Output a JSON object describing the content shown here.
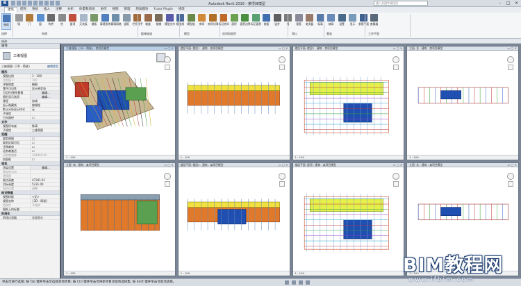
{
  "titlebar": {
    "app_letter": "R",
    "title": "Autodesk Revit 2016 -   某项目模型",
    "search_placeholder": "键入关键字或短语",
    "min": "–",
    "max": "□",
    "close": "✕"
  },
  "tabs": [
    "建筑",
    "结构",
    "系统",
    "插入",
    "注释",
    "分析",
    "体量和场地",
    "协作",
    "视图",
    "管理",
    "附加模块",
    "Fuzor Plugin",
    "修改"
  ],
  "ribbon": {
    "buttons": [
      "修改",
      "墙",
      "门",
      "窗",
      "构件",
      "柱",
      "屋顶",
      "天花板",
      "楼板",
      "幕墙系统",
      "幕墙网格",
      "竖梃",
      "栏杆扶手",
      "坡道",
      "楼梯",
      "模型文字",
      "模型线",
      "模型组",
      "房间",
      "房间分隔",
      "标记房间",
      "面积",
      "面积边界",
      "标记面积",
      "按面",
      "竖井",
      "墙",
      "垂直",
      "老虎窗",
      "标高",
      "轴网",
      "设置",
      "显示",
      "参照平面",
      "查看器"
    ],
    "panels": [
      "选择",
      "构建",
      "楼梯坡道",
      "模型",
      "房间和面积",
      "洞口",
      "基准",
      "工作平面"
    ]
  },
  "substrip": {
    "label": "修改"
  },
  "properties": {
    "title": "属性",
    "type_name": "三维视图",
    "filter_label": "三维视图: {3D - 简易}",
    "edit_type": "编辑类型",
    "groups": [
      {
        "name": "图形",
        "rows": [
          {
            "k": "视图比例",
            "v": "1 : 100"
          },
          {
            "k": "比例值 1:",
            "v": "100",
            "grey": true
          },
          {
            "k": "详细程度",
            "v": "精细"
          },
          {
            "k": "零件可见性",
            "v": "显示原状态"
          },
          {
            "k": "可见性/图形替换",
            "v": "编辑...",
            "btn": true
          },
          {
            "k": "图形显示选项",
            "v": "编辑...",
            "btn": true
          },
          {
            "k": "规程",
            "v": "协调"
          },
          {
            "k": "显示隐藏线",
            "v": "按规程"
          },
          {
            "k": "默认分析显示样式",
            "v": "无"
          },
          {
            "k": "子规程",
            "v": ""
          },
          {
            "k": "日光路径",
            "v": "☐"
          }
        ]
      },
      {
        "name": "文字",
        "rows": [
          {
            "k": "视图所有者",
            "v": "陈瑛"
          },
          {
            "k": "子规程",
            "v": "三维视图"
          }
        ]
      },
      {
        "name": "范围",
        "rows": [
          {
            "k": "裁剪视图",
            "v": "☐"
          },
          {
            "k": "裁剪区域可见",
            "v": "☐"
          },
          {
            "k": "注释裁剪",
            "v": "☐"
          },
          {
            "k": "远剪裁激活",
            "v": "☐"
          },
          {
            "k": "远剪裁偏移",
            "v": "304800.00",
            "grey": true
          },
          {
            "k": "剖面框",
            "v": "☐"
          }
        ]
      },
      {
        "name": "相机",
        "rows": [
          {
            "k": "渲染设置",
            "v": "编辑...",
            "btn": true
          },
          {
            "k": "锁定的方向",
            "v": "",
            "grey": true
          },
          {
            "k": "透视图",
            "v": "",
            "grey": true
          },
          {
            "k": "视点高度",
            "v": "47341.61"
          },
          {
            "k": "目标高度",
            "v": "5231.00"
          },
          {
            "k": "相机位置",
            "v": "调整",
            "grey": true
          }
        ]
      },
      {
        "name": "标识数据",
        "rows": [
          {
            "k": "视图样板",
            "v": "<无>"
          },
          {
            "k": "视图名称",
            "v": "{3D - 简易}"
          },
          {
            "k": "相关性",
            "v": "不相关",
            "grey": true
          },
          {
            "k": "图纸上的标题",
            "v": ""
          }
        ]
      },
      {
        "name": "阶段化",
        "rows": [
          {
            "k": "阶段过滤器",
            "v": "全部显示"
          }
        ]
      }
    ]
  },
  "views": [
    {
      "title": "三维视图: {3D - 简易} - 某项目模型",
      "scale": "1 : 100"
    },
    {
      "title": "楼层平面: 楼层1 - 建筑 - 某项目模型",
      "scale": "1 : 100"
    },
    {
      "title": "楼层平面: 楼层2 - 建筑 - 某项目模型",
      "scale": "1 : 100"
    },
    {
      "title": "立面: 东 - 建筑 - 某项目模型",
      "scale": "1 : 100"
    },
    {
      "title": "立面: 南 - 建筑 - 某项目模型",
      "scale": "1 : 100"
    },
    {
      "title": "楼层平面: 楼层3 - 建筑 - 某项目模型",
      "scale": "1 : 100"
    },
    {
      "title": "楼层平面: 屋顶 - 建筑 - 某项目模型",
      "scale": "1 : 100"
    },
    {
      "title": "立面: 北 - 建筑 - 某项目模型",
      "scale": "1 : 100"
    }
  ],
  "status": {
    "text": "单击可进行选择; 按 Tab 键并单击可选择其他项目; 按 Ctrl 键并单击可将新项目添加到选择集; 按 Shift 键并单击可取消选择。"
  },
  "watermark": {
    "line1": "BIM教程网",
    "line2": "www.ifbim.com"
  }
}
